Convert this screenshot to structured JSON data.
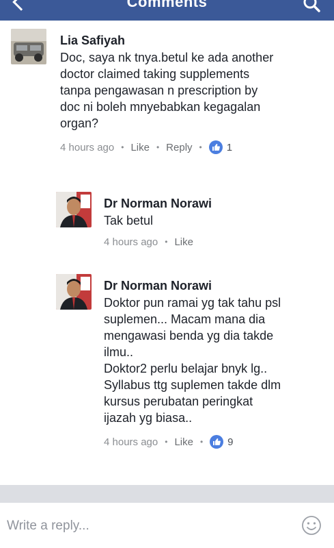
{
  "header": {
    "title": "Comments",
    "back_icon": "back-arrow-icon",
    "search_icon": "search-icon",
    "background": "#3b5998"
  },
  "comments": [
    {
      "author": "Lia Safiyah",
      "text": "Doc, saya nk tnya.betul ke ada another\ndoctor claimed taking supplements\ntanpa pengawasan n prescription by\ndoc ni boleh mnyebabkan kegagalan\norgan?",
      "time": "4 hours ago",
      "like_label": "Like",
      "reply_label": "Reply",
      "reactions": "1"
    },
    {
      "author": "Dr Norman Norawi",
      "text": "Tak betul",
      "time": "4 hours ago",
      "like_label": "Like"
    },
    {
      "author": "Dr Norman Norawi",
      "text": "Doktor pun ramai yg tak tahu psl\nsuplemen... Macam mana dia\nmengawasi benda yg dia takde\nilmu..\nDoktor2 perlu belajar bnyk lg..\nSyllabus ttg suplemen takde dlm\nkursus perubatan peringkat\nijazah yg biasa..",
      "time": "4 hours ago",
      "like_label": "Like",
      "reactions": "9"
    }
  ],
  "reply_box": {
    "placeholder": "Write a reply...",
    "emoji_icon": "emoji-smile-icon"
  },
  "colors": {
    "like_badge": "#4b7ee0",
    "meta_text": "#8a8d91"
  }
}
